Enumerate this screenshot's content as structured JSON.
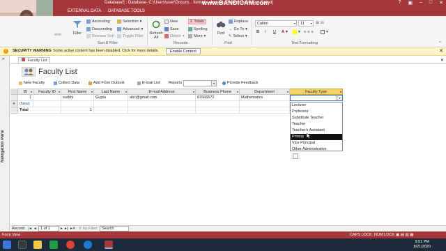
{
  "window": {
    "title": "Database5 : Database- C:\\Users\\user\\Docum... format) - Access (Product Activation Failed)",
    "recorder_watermark": "www.BANDICAM.com"
  },
  "ribbon_tabs": [
    "EXTERNAL DATA",
    "DATABASE TOOLS"
  ],
  "ribbon": {
    "filter": "Filter",
    "ascending": "Ascending",
    "descending": "Descending",
    "remove_sort": "Remove Sort",
    "selection": "Selection",
    "advanced": "Advanced",
    "toggle_filter": "Toggle Filter",
    "sort_filter_group": "Sort & Filter",
    "refresh": "Refresh All",
    "new": "New",
    "save": "Save",
    "delete": "Delete",
    "totals": "Totals",
    "spelling": "Spelling",
    "more": "More",
    "records_group": "Records",
    "find": "Find",
    "replace": "Replace",
    "goto": "Go To",
    "select": "Select",
    "find_group": "Find",
    "font_name": "Calibri",
    "font_size": "11",
    "text_formatting_group": "Text Formatting",
    "format_buttons": [
      "B",
      "I",
      "U"
    ],
    "partial_label": "inter"
  },
  "security": {
    "label": "SECURITY WARNING",
    "message": "Some active content has been disabled. Click for more details.",
    "button": "Enable Content"
  },
  "nav_pane_label": "Navigation Pane",
  "document_tab": "Faculty List",
  "form": {
    "title": "Faculty List",
    "toolbar": {
      "new_faculty": "New Faculty",
      "collect_data": "Collect Data",
      "add_outlook": "Add From Outlook",
      "email_list": "E-mail List",
      "reports": "Reports",
      "feedback": "Provide Feedback"
    },
    "columns": [
      "ID",
      "Faculty ID",
      "First Name",
      "Last Name",
      "E-mail Address",
      "Business Phone",
      "Department",
      "Faculty Type"
    ],
    "rows": [
      {
        "id": "1",
        "faculty_id": "",
        "first_name": "surbhi",
        "last_name": "Gupta",
        "email": "abc@gmail.com",
        "phone": "87666572",
        "department": "Mathematics",
        "faculty_type": ""
      }
    ],
    "new_row": "(New)",
    "total_label": "Total",
    "total_value": "1",
    "faculty_type_options": [
      "Lecturer",
      "Professor",
      "Substitute Teacher",
      "Teacher",
      "Teacher's Assistant",
      "Principal",
      "Vice Principal",
      "Other Administrative"
    ],
    "highlighted_option": "Principal",
    "highlighted_option_visible": "Princip"
  },
  "record_nav": {
    "label": "Record:",
    "position": "1 of 1",
    "filter": "No Filter",
    "search": "Search"
  },
  "status": {
    "view": "Form View",
    "caps": "CAPS LOCK",
    "num": "NUM LOCK"
  },
  "clock": {
    "time": "9:51 PM",
    "date": "8/21/2020"
  },
  "colors": {
    "access_red": "#a4373a",
    "security_yellow": "#fff4c6",
    "header_gold": "#f3d46c"
  }
}
